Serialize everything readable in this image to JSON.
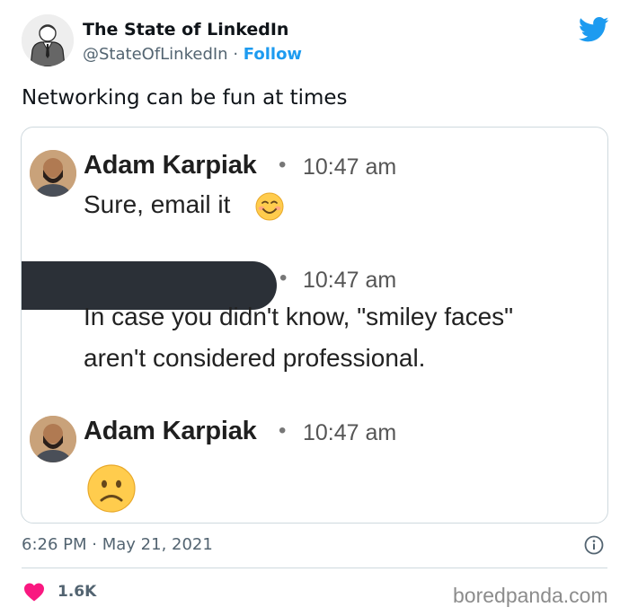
{
  "author": {
    "display_name": "The State of LinkedIn",
    "handle": "@StateOfLinkedIn",
    "separator": "·",
    "follow_label": "Follow"
  },
  "tweet": {
    "text": "Networking can be fun at times"
  },
  "screenshot": {
    "messages": [
      {
        "name": "Adam Karpiak",
        "dot": "•",
        "time": "10:47 am",
        "text": "Sure, email it",
        "emoji": "smiling-face-icon"
      },
      {
        "name": "",
        "dot": "•",
        "time": "10:47 am",
        "lines": [
          "In case you didn't know, \"smiley faces\"",
          "aren't considered professional."
        ],
        "redacted": true
      },
      {
        "name": "Adam Karpiak",
        "dot": "•",
        "time": "10:47 am",
        "emoji": "frowning-face-icon"
      }
    ]
  },
  "meta": {
    "time": "6:26 PM",
    "separator": "·",
    "date": "May 21, 2021"
  },
  "engagement": {
    "likes": "1.6K"
  },
  "watermark": "boredpanda.com",
  "colors": {
    "twitter_blue": "#1d9bf0",
    "heart_red": "#f91880",
    "redaction": "#2b3037"
  }
}
